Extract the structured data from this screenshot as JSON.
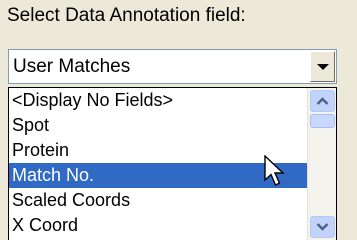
{
  "label": "Select Data Annotation field:",
  "combo": {
    "value": "User Matches",
    "button_icon": "chevron-down-icon"
  },
  "dropdown": {
    "items": [
      {
        "label": "<Display No Fields>",
        "selected": false
      },
      {
        "label": "Spot",
        "selected": false
      },
      {
        "label": "Protein",
        "selected": false
      },
      {
        "label": "Match No.",
        "selected": true
      },
      {
        "label": "Scaled Coords",
        "selected": false
      },
      {
        "label": "X Coord",
        "selected": false
      }
    ]
  },
  "colors": {
    "selection": "#316ac5",
    "scrollbar_button": "#c1d3fb"
  }
}
